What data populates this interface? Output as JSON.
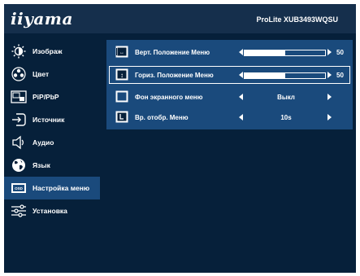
{
  "header": {
    "logo": "iiyama",
    "model": "ProLite XUB3493WQSU"
  },
  "sidebar": {
    "items": [
      {
        "label": "Изображ",
        "icon": "brightness-icon"
      },
      {
        "label": "Цвет",
        "icon": "color-palette-icon"
      },
      {
        "label": "PiP/PbP",
        "icon": "pip-icon"
      },
      {
        "label": "Источник",
        "icon": "input-source-icon"
      },
      {
        "label": "Аудио",
        "icon": "speaker-icon"
      },
      {
        "label": "Язык",
        "icon": "globe-icon"
      },
      {
        "label": "Настройка меню",
        "icon": "osd-settings-icon"
      },
      {
        "label": "Установка",
        "icon": "sliders-icon"
      }
    ],
    "active_index": 6
  },
  "menu": {
    "rows": [
      {
        "label": "Верт. Положение Меню",
        "icon": "vertical-position-icon",
        "level": 50,
        "value": "50"
      },
      {
        "label": "Гориз. Положение Меню",
        "icon": "horizontal-position-icon",
        "level": 50,
        "value": "50"
      },
      {
        "label": "Фон экранного меню",
        "icon": "menu-background-icon",
        "value": "Выкл"
      },
      {
        "label": "Вр. отобр. Меню",
        "icon": "menu-timer-icon",
        "value": "10s"
      }
    ],
    "selected_index": 1
  },
  "colors": {
    "background": "#06203a",
    "panel": "#1a4a7c",
    "header": "#152f4c",
    "text": "#ffffff"
  }
}
